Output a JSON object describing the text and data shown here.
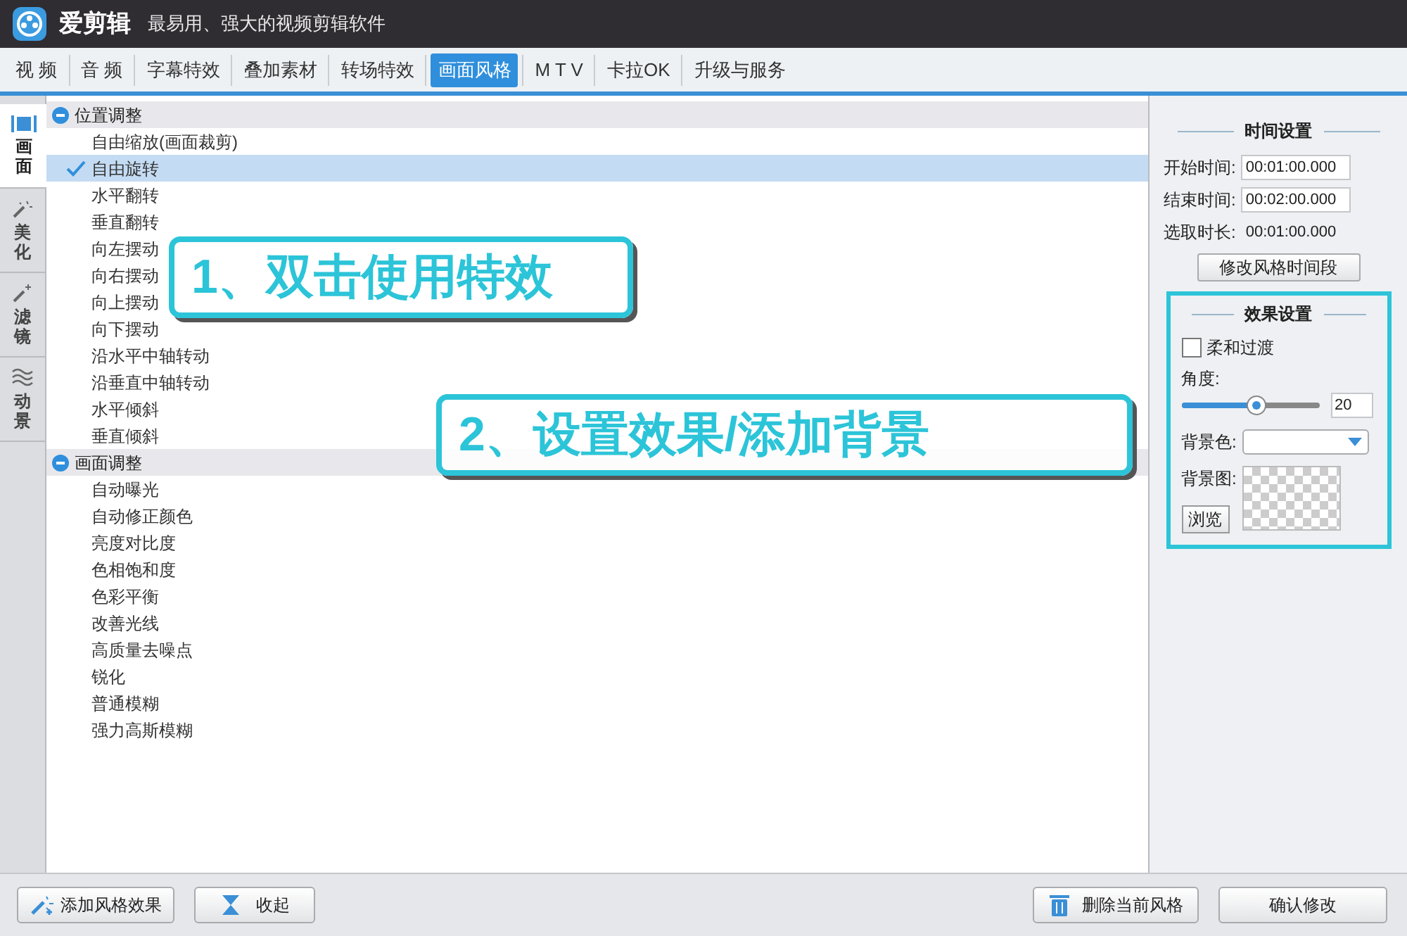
{
  "window": {
    "app_name": "爱剪辑",
    "subtitle": "最易用、强大的视频剪辑软件"
  },
  "tabs": [
    {
      "label": "视 频",
      "selected": false
    },
    {
      "label": "音 频",
      "selected": false
    },
    {
      "label": "字幕特效",
      "selected": false
    },
    {
      "label": "叠加素材",
      "selected": false
    },
    {
      "label": "转场特效",
      "selected": false
    },
    {
      "label": "画面风格",
      "selected": true
    },
    {
      "label": "M T V",
      "selected": false
    },
    {
      "label": "卡拉OK",
      "selected": false
    },
    {
      "label": "升级与服务",
      "selected": false
    }
  ],
  "side_tabs": [
    {
      "label": "画面",
      "selected": true
    },
    {
      "label": "美化",
      "selected": false
    },
    {
      "label": "滤镜",
      "selected": false
    },
    {
      "label": "动景",
      "selected": false
    }
  ],
  "effect_groups": [
    {
      "title": "位置调整",
      "expanded": true,
      "children": [
        {
          "label": "自由缩放(画面裁剪)",
          "selected": false
        },
        {
          "label": "自由旋转",
          "selected": true
        },
        {
          "label": "水平翻转",
          "selected": false
        },
        {
          "label": "垂直翻转",
          "selected": false
        },
        {
          "label": "向左摆动",
          "selected": false
        },
        {
          "label": "向右摆动",
          "selected": false
        },
        {
          "label": "向上摆动",
          "selected": false
        },
        {
          "label": "向下摆动",
          "selected": false
        },
        {
          "label": "沿水平中轴转动",
          "selected": false
        },
        {
          "label": "沿垂直中轴转动",
          "selected": false
        },
        {
          "label": "水平倾斜",
          "selected": false
        },
        {
          "label": "垂直倾斜",
          "selected": false
        }
      ]
    },
    {
      "title": "画面调整",
      "expanded": true,
      "children": [
        {
          "label": "自动曝光",
          "selected": false
        },
        {
          "label": "自动修正颜色",
          "selected": false
        },
        {
          "label": "亮度对比度",
          "selected": false
        },
        {
          "label": "色相饱和度",
          "selected": false
        },
        {
          "label": "色彩平衡",
          "selected": false
        },
        {
          "label": "改善光线",
          "selected": false
        },
        {
          "label": "高质量去噪点",
          "selected": false
        },
        {
          "label": "锐化",
          "selected": false
        },
        {
          "label": "普通模糊",
          "selected": false
        },
        {
          "label": "强力高斯模糊",
          "selected": false
        }
      ]
    }
  ],
  "time_settings": {
    "title": "时间设置",
    "start_label": "开始时间:",
    "start_value": "00:01:00.000",
    "end_label": "结束时间:",
    "end_value": "00:02:00.000",
    "duration_label": "选取时长:",
    "duration_value": "00:01:00.000",
    "button": "修改风格时间段"
  },
  "effect_settings": {
    "title": "效果设置",
    "soft_transition": {
      "label": "柔和过渡",
      "checked": false
    },
    "angle_label": "角度:",
    "angle": {
      "level": 0.55,
      "value": "20"
    },
    "bg_color_label": "背景色:",
    "bg_image_label": "背景图:",
    "browse_button": "浏览"
  },
  "annotations": [
    "1、双击使用特效",
    "2、设置效果/添加背景"
  ],
  "bottom_buttons": {
    "left": [
      "添加风格效果",
      "收起"
    ],
    "delete": "删除当前风格",
    "confirm": "确认修改"
  }
}
